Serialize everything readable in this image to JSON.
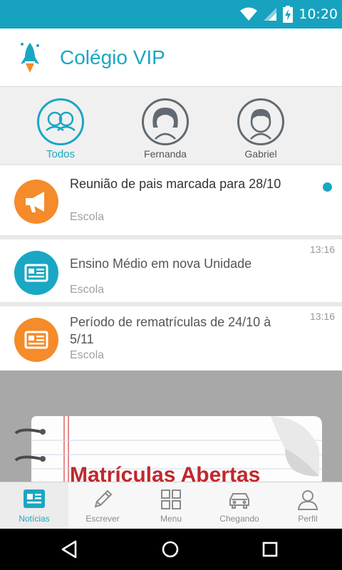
{
  "status_bar": {
    "time": "10:20",
    "icons": [
      "wifi-icon",
      "cell-signal-icon",
      "battery-charging-icon"
    ]
  },
  "header": {
    "title": "Colégio VIP",
    "logo_icon": "rocket-logo"
  },
  "profiles": [
    {
      "name": "Todos",
      "icon": "group-icon",
      "active": true
    },
    {
      "name": "Fernanda",
      "icon": "girl-avatar-icon",
      "active": false
    },
    {
      "name": "Gabriel",
      "icon": "boy-avatar-icon",
      "active": false
    }
  ],
  "feed": [
    {
      "title": "Reunião de pais marcada para 28/10",
      "source": "Escola",
      "time": "",
      "unread": true,
      "icon": "megaphone-icon",
      "color": "#f58b2a"
    },
    {
      "title": "Ensino Médio em nova Unidade",
      "source": "Escola",
      "time": "13:16",
      "unread": false,
      "icon": "newspaper-icon",
      "color": "#1aa7c3"
    },
    {
      "title": "Período de rematrículas de 24/10 à 5/11",
      "source": "Escola",
      "time": "13:16",
      "unread": false,
      "icon": "newspaper-icon",
      "color": "#f58b2a"
    }
  ],
  "banner": {
    "text": "Matrículas Abertas"
  },
  "bottom_nav": [
    {
      "label": "Notícias",
      "icon": "news-icon",
      "active": true
    },
    {
      "label": "Escrever",
      "icon": "pencil-icon",
      "active": false
    },
    {
      "label": "Menu",
      "icon": "grid-icon",
      "active": false
    },
    {
      "label": "Chegando",
      "icon": "car-icon",
      "active": false
    },
    {
      "label": "Perfil",
      "icon": "person-icon",
      "active": false
    }
  ],
  "colors": {
    "brand": "#1aa7c3",
    "accent_orange": "#f58b2a",
    "status_bar": "#17a2bf"
  }
}
